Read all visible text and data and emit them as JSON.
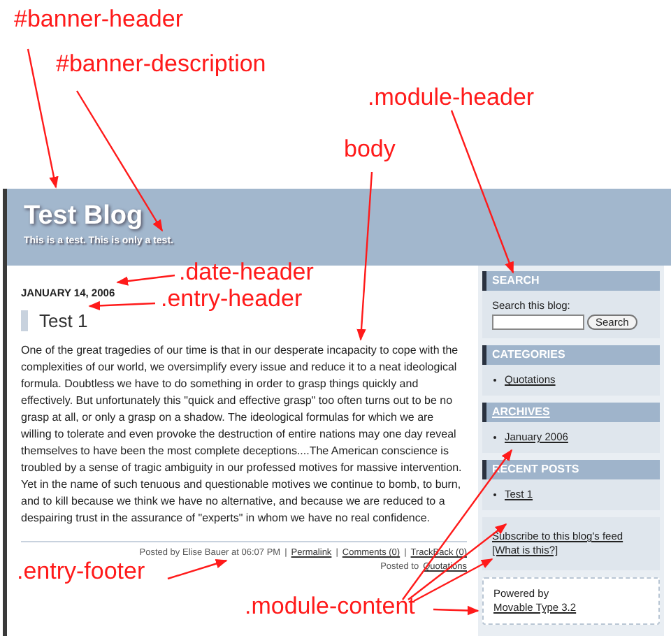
{
  "annotations": [
    {
      "label": "#banner-header"
    },
    {
      "label": "#banner-description"
    },
    {
      "label": ".module-header"
    },
    {
      "label": "body"
    },
    {
      "label": ".date-header"
    },
    {
      "label": ".entry-header"
    },
    {
      "label": ".entry-footer"
    },
    {
      "label": ".module-content"
    }
  ],
  "banner": {
    "title": "Test Blog",
    "description": "This is a test. This is only a test."
  },
  "entry": {
    "date": "JANUARY 14, 2006",
    "title": "Test 1",
    "body": "One of the great tragedies of our time is that in our desperate incapacity to cope with the complexities of our world, we oversimplify every issue and reduce it to a neat ideological formula. Doubtless we have to do something in order to grasp things quickly and effectively. But unfortunately this \"quick and effective grasp\" too often turns out to be no grasp at all, or only a grasp on a shadow. The ideological formulas for which we are willing to tolerate and even provoke the destruction of entire nations may one day reveal themselves to have been the most complete deceptions....The American conscience is troubled by a sense of tragic ambiguity in our professed motives for massive intervention. Yet in the name of such tenuous and questionable motives we continue to bomb, to burn, and to kill because we think we have no alternative, and because we are reduced to a despairing trust in the assurance of \"experts\" in whom we have no real confidence.",
    "footer": {
      "posted_by": "Posted by Elise Bauer at 06:07 PM",
      "separator": "|",
      "links": [
        "Permalink",
        "Comments (0)",
        "TrackBack (0)"
      ],
      "posted_to": "Posted to",
      "category": "Quotations"
    }
  },
  "sidebar": [
    {
      "kind": "search",
      "header": "SEARCH",
      "header_link": false,
      "label": "Search this blog:",
      "button": "Search"
    },
    {
      "kind": "list",
      "header": "CATEGORIES",
      "header_link": false,
      "items": [
        "Quotations"
      ]
    },
    {
      "kind": "list",
      "header": "ARCHIVES",
      "header_link": true,
      "items": [
        "January 2006"
      ]
    },
    {
      "kind": "list",
      "header": "RECENT POSTS",
      "header_link": false,
      "items": [
        "Test 1"
      ]
    },
    {
      "kind": "links",
      "links": [
        "Subscribe to this blog's feed",
        "[What is this?]"
      ]
    },
    {
      "kind": "powered",
      "text": "Powered by",
      "link": "Movable Type 3.2"
    }
  ]
}
